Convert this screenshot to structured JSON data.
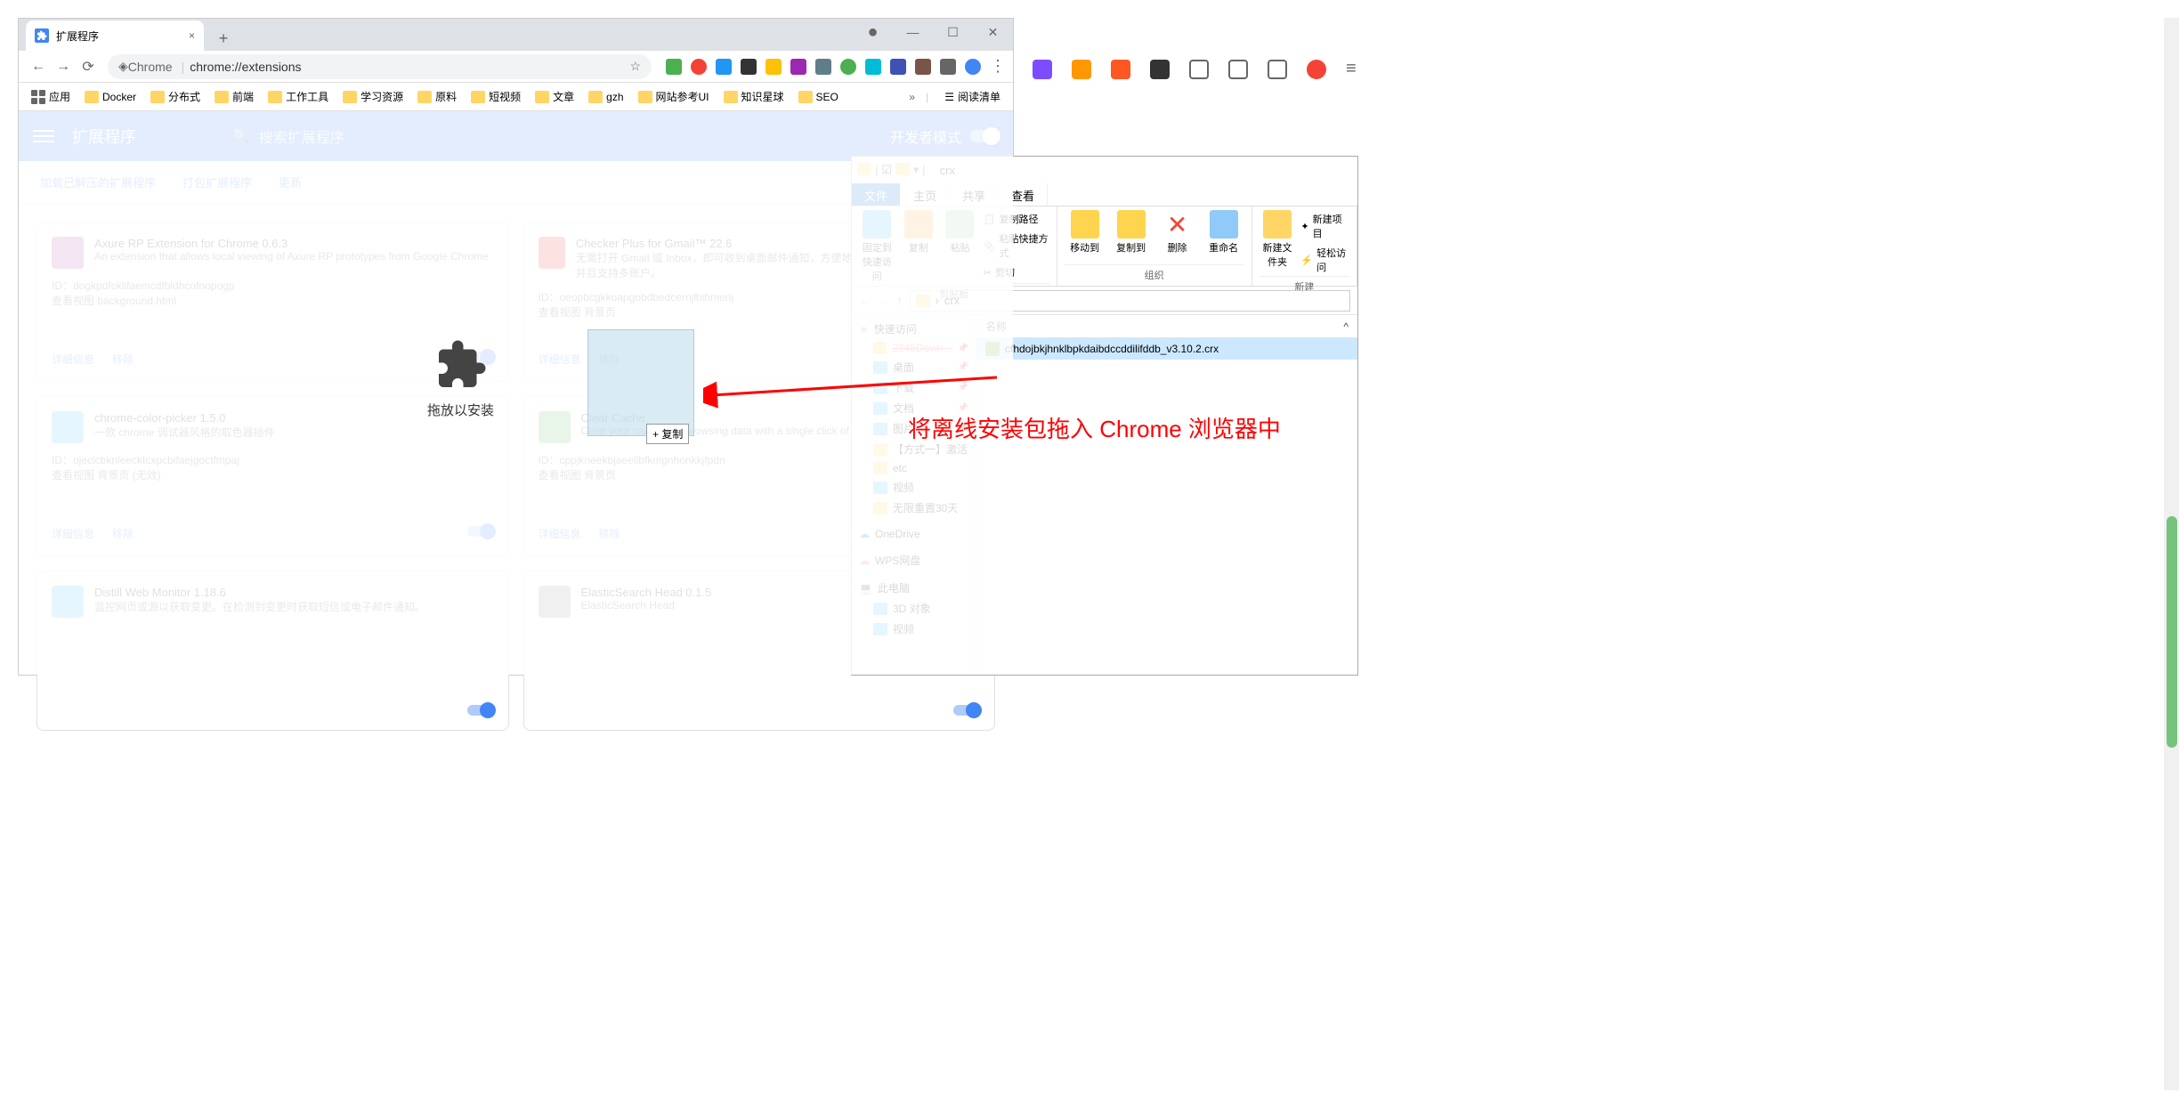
{
  "chrome": {
    "tab_title": "扩展程序",
    "url_prefix": "Chrome",
    "url": "chrome://extensions",
    "bookmarks": [
      "应用",
      "Docker",
      "分布式",
      "前端",
      "工作工具",
      "学习资源",
      "原料",
      "短视频",
      "文章",
      "gzh",
      "网站参考UI",
      "知识星球",
      "SEO"
    ],
    "bookmarks_more": "»",
    "reading_list": "阅读清单"
  },
  "ext_page": {
    "title": "扩展程序",
    "search_placeholder": "搜索扩展程序",
    "dev_mode": "开发者模式",
    "toolbar": {
      "load": "加载已解压的扩展程序",
      "pack": "打包扩展程序",
      "update": "更新"
    },
    "drop_label": "拖放以安装",
    "copy_hint": "+ 复制",
    "cards": [
      {
        "title": "Axure RP Extension for Chrome  0.6.3",
        "desc": "An extension that allows local viewing of Axure RP prototypes from Google Chrome",
        "id": "ID：dogkpdfcklifaemcdfbldhcofnopogp",
        "view": "查看视图 background.html",
        "details": "详细信息",
        "remove": "移除",
        "color": "#b453a6"
      },
      {
        "title": "Checker Plus for Gmail™  22.6",
        "desc": "无需打开 Gmail 或 Inbox，即可收到桌面邮件通知，方便地查看、收听或删除邮件，并且支持多账户。",
        "id": "ID：oeopbcgkkoapgobdbedcernjlbihmenj",
        "view": "查看视图 背景页",
        "details": "详细信息",
        "remove": "移除",
        "color": "#ea4335"
      },
      {
        "title": "chrome-color-picker  1.5.0",
        "desc": "一款 chrome 调试器风格的取色器插件",
        "id": "ID：ojeclcbknleecktcxpcbifaejgoctfmpaj",
        "view": "查看视图 背景页 (无效)",
        "details": "详细信息",
        "remove": "移除",
        "color": "#4fc3f7"
      },
      {
        "title": "Clear Cache",
        "desc": "Clear your cache and browsing data with a single click of a button",
        "id": "ID：cppjkneekbjaeellbfkmgnhonkkjfpdn",
        "view": "查看视图 背景页",
        "details": "详细信息",
        "remove": "移除",
        "color": "#66bb6a"
      },
      {
        "title": "Distill Web Monitor  1.18.6",
        "desc": "监控网页或源以获取变更。在检测到变更时获取短信或电子邮件通知。",
        "id": "",
        "view": "",
        "details": "",
        "remove": "",
        "color": "#4fc3f7"
      },
      {
        "title": "ElasticSearch Head  0.1.5",
        "desc": "ElasticSearch Head",
        "id": "",
        "view": "",
        "details": "",
        "remove": "",
        "color": "#999"
      }
    ]
  },
  "explorer": {
    "title": "crx",
    "tabs": {
      "file": "文件",
      "home": "主页",
      "share": "共享",
      "view": "查看"
    },
    "ribbon": {
      "pin": "固定到快速访问",
      "copy": "复制",
      "paste": "粘贴",
      "copy_path": "复制路径",
      "paste_shortcut": "粘贴快捷方式",
      "cut": "剪切",
      "clipboard_label": "剪贴板",
      "moveto": "移动到",
      "copyto": "复制到",
      "delete": "删除",
      "rename": "重命名",
      "organize_label": "组织",
      "new_folder": "新建文件夹",
      "new_item": "新建项目",
      "easy_access": "轻松访问",
      "new_label": "新建"
    },
    "path": "crx",
    "col_name": "名称",
    "sidebar": {
      "quick": "快速访问",
      "desktop": "桌面",
      "downloads": "下载",
      "documents": "文档",
      "pictures": "图片",
      "method1": "【方式一】激活",
      "etc": "etc",
      "video": "视频",
      "reset30": "无限重置30天",
      "onedrive": "OneDrive",
      "wps": "WPS网盘",
      "thispc": "此电脑",
      "3d": "3D 对象",
      "video2": "视频"
    },
    "file": "cfhdojbkjhnklbpkdaibdccddilifddb_v3.10.2.crx"
  },
  "annotation": "将离线安装包拖入 Chrome 浏览器中"
}
